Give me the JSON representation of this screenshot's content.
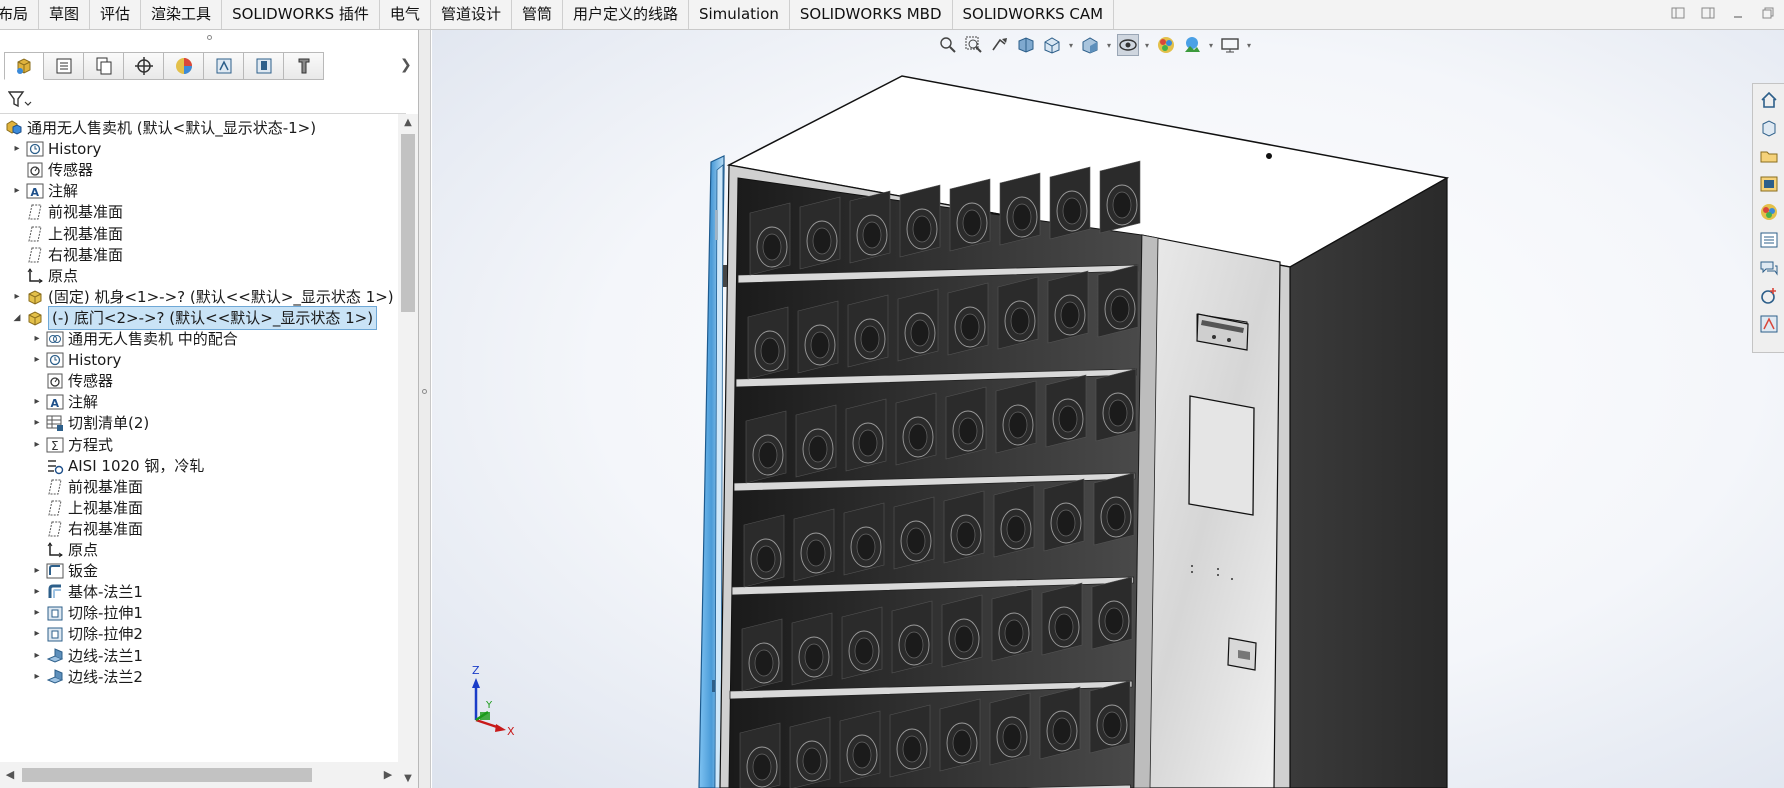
{
  "tabs": [
    {
      "label": "布局"
    },
    {
      "label": "草图"
    },
    {
      "label": "评估"
    },
    {
      "label": "渲染工具"
    },
    {
      "label": "SOLIDWORKS 插件"
    },
    {
      "label": "电气"
    },
    {
      "label": "管道设计"
    },
    {
      "label": "管筒"
    },
    {
      "label": "用户定义的线路"
    },
    {
      "label": "Simulation"
    },
    {
      "label": "SOLIDWORKS MBD"
    },
    {
      "label": "SOLIDWORKS CAM"
    }
  ],
  "manager_tabs": [
    {
      "icon": "feature-manager-icon"
    },
    {
      "icon": "property-manager-icon"
    },
    {
      "icon": "configuration-manager-icon"
    },
    {
      "icon": "dimxpert-manager-icon"
    },
    {
      "icon": "display-manager-icon"
    },
    {
      "icon": "cam-feature-tree-icon"
    },
    {
      "icon": "cam-operation-tree-icon"
    },
    {
      "icon": "cam-tool-tree-icon"
    }
  ],
  "tree": [
    {
      "label": "通用无人售卖机  (默认<默认_显示状态-1>)",
      "level": 0,
      "expander": "",
      "icon": "assembly-icon"
    },
    {
      "label": "History",
      "level": 1,
      "expander": "right",
      "icon": "history-icon"
    },
    {
      "label": "传感器",
      "level": 1,
      "expander": "",
      "icon": "sensor-icon"
    },
    {
      "label": "注解",
      "level": 1,
      "expander": "right",
      "icon": "annotation-icon"
    },
    {
      "label": "前视基准面",
      "level": 1,
      "expander": "",
      "icon": "plane-icon"
    },
    {
      "label": "上视基准面",
      "level": 1,
      "expander": "",
      "icon": "plane-icon"
    },
    {
      "label": "右视基准面",
      "level": 1,
      "expander": "",
      "icon": "plane-icon"
    },
    {
      "label": "原点",
      "level": 1,
      "expander": "",
      "icon": "origin-icon"
    },
    {
      "label": "(固定) 机身<1>->? (默认<<默认>_显示状态 1>)",
      "level": 1,
      "expander": "right",
      "icon": "part-icon"
    },
    {
      "label": "(-) 底门<2>->? (默认<<默认>_显示状态 1>)",
      "level": 1,
      "expander": "down",
      "icon": "part-icon",
      "selected": true
    },
    {
      "label": "通用无人售卖机 中的配合",
      "level": 2,
      "expander": "right",
      "icon": "mates-icon"
    },
    {
      "label": "History",
      "level": 2,
      "expander": "right",
      "icon": "history-icon"
    },
    {
      "label": "传感器",
      "level": 2,
      "expander": "",
      "icon": "sensor-icon"
    },
    {
      "label": "注解",
      "level": 2,
      "expander": "right",
      "icon": "annotation-icon"
    },
    {
      "label": "切割清单(2)",
      "level": 2,
      "expander": "right",
      "icon": "cutlist-icon"
    },
    {
      "label": "方程式",
      "level": 2,
      "expander": "right",
      "icon": "equation-icon"
    },
    {
      "label": "AISI 1020 钢，冷轧",
      "level": 2,
      "expander": "",
      "icon": "material-icon"
    },
    {
      "label": "前视基准面",
      "level": 2,
      "expander": "",
      "icon": "plane-icon"
    },
    {
      "label": "上视基准面",
      "level": 2,
      "expander": "",
      "icon": "plane-icon"
    },
    {
      "label": "右视基准面",
      "level": 2,
      "expander": "",
      "icon": "plane-icon"
    },
    {
      "label": "原点",
      "level": 2,
      "expander": "",
      "icon": "origin-icon"
    },
    {
      "label": "钣金",
      "level": 2,
      "expander": "right",
      "icon": "sheetmetal-icon"
    },
    {
      "label": "基体-法兰1",
      "level": 2,
      "expander": "right",
      "icon": "base-flange-icon"
    },
    {
      "label": "切除-拉伸1",
      "level": 2,
      "expander": "right",
      "icon": "cut-extrude-icon"
    },
    {
      "label": "切除-拉伸2",
      "level": 2,
      "expander": "right",
      "icon": "cut-extrude-icon"
    },
    {
      "label": "边线-法兰1",
      "level": 2,
      "expander": "right",
      "icon": "edge-flange-icon"
    },
    {
      "label": "边线-法兰2",
      "level": 2,
      "expander": "right",
      "icon": "edge-flange-icon"
    }
  ],
  "axes": {
    "x": "X",
    "y": "Y",
    "z": "Z"
  },
  "colors": {
    "selection": "#c9e3f6",
    "selection_border": "#6fa8d6",
    "door_glass": "#5aa9e6"
  }
}
